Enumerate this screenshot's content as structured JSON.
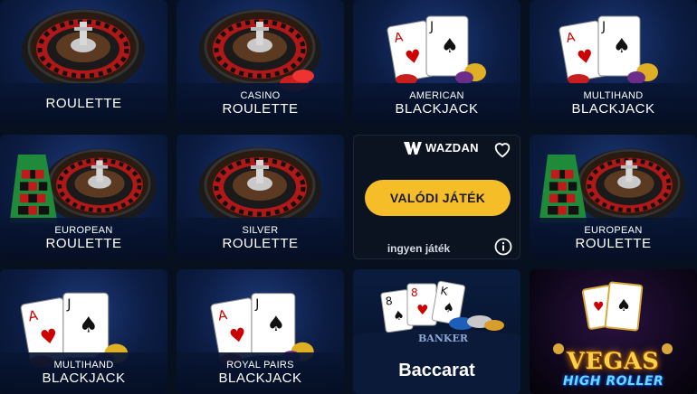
{
  "tiles": [
    {
      "sub": "",
      "main": "ROULETTE"
    },
    {
      "sub": "CASINO",
      "main": "ROULETTE"
    },
    {
      "sub": "AMERICAN",
      "main": "BLACKJACK"
    },
    {
      "sub": "MULTIHAND",
      "main": "BLACKJACK"
    },
    {
      "sub": "EUROPEAN",
      "main": "ROULETTE"
    },
    {
      "sub": "SILVER",
      "main": "ROULETTE"
    },
    {
      "sub": "EUROPEAN",
      "main": "ROULETTE"
    },
    {
      "sub": "MULTIHAND",
      "main": "BLACKJACK"
    },
    {
      "sub": "ROYAL PAIRS",
      "main": "BLACKJACK"
    }
  ],
  "hover_tile": {
    "provider": "WAZDAN",
    "play_label": "VALÓDI JÁTÉK",
    "free_label": "ingyen játék"
  },
  "baccarat": {
    "title": "Baccarat",
    "banker": "BANKER"
  },
  "vegas": {
    "line1": "VEGAS",
    "line2": "HIGH ROLLER"
  },
  "colors": {
    "accent_button": "#f5bd28",
    "tile_bg": "#0c1d44",
    "page_bg": "#07101f"
  },
  "icons": [
    "wazdan-logo-icon",
    "heart-icon",
    "info-icon"
  ]
}
